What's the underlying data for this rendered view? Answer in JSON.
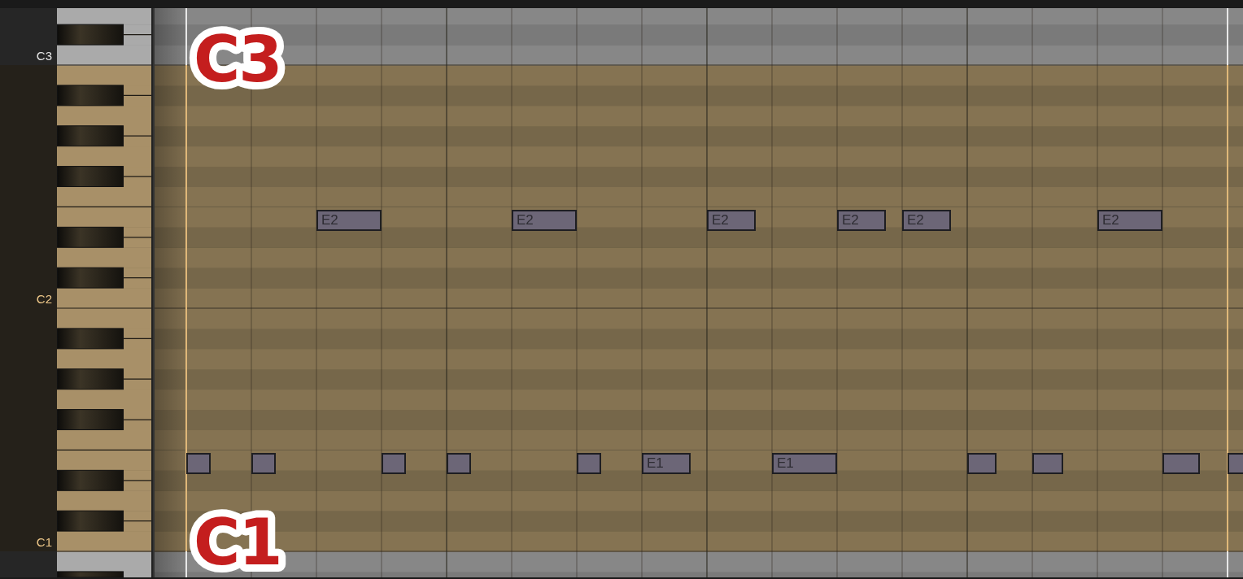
{
  "keyboard": {
    "labels": [
      {
        "text": "C3",
        "in_range": false
      },
      {
        "text": "C2",
        "in_range": true
      },
      {
        "text": "C1",
        "in_range": true
      }
    ]
  },
  "lanes": [
    {
      "notes": [
        {
          "kind": "note",
          "label": "E2"
        },
        {
          "kind": "note",
          "label": "E2"
        },
        {
          "kind": "note",
          "label": "E2"
        },
        {
          "kind": "note",
          "label": "E2"
        },
        {
          "kind": "note",
          "label": "E2"
        },
        {
          "kind": "note",
          "label": "E2"
        }
      ]
    },
    {
      "notes": [
        {
          "kind": "note"
        },
        {
          "kind": "note"
        },
        {
          "kind": "note"
        },
        {
          "kind": "note"
        },
        {
          "kind": "note"
        },
        {
          "kind": "note",
          "label": "E1"
        },
        {
          "kind": "note",
          "label": "E1"
        },
        {
          "kind": "note"
        },
        {
          "kind": "note"
        },
        {
          "kind": "note"
        },
        {
          "kind": "note"
        }
      ]
    }
  ],
  "annotations": [
    {
      "text": "C3"
    },
    {
      "text": "C1"
    }
  ]
}
